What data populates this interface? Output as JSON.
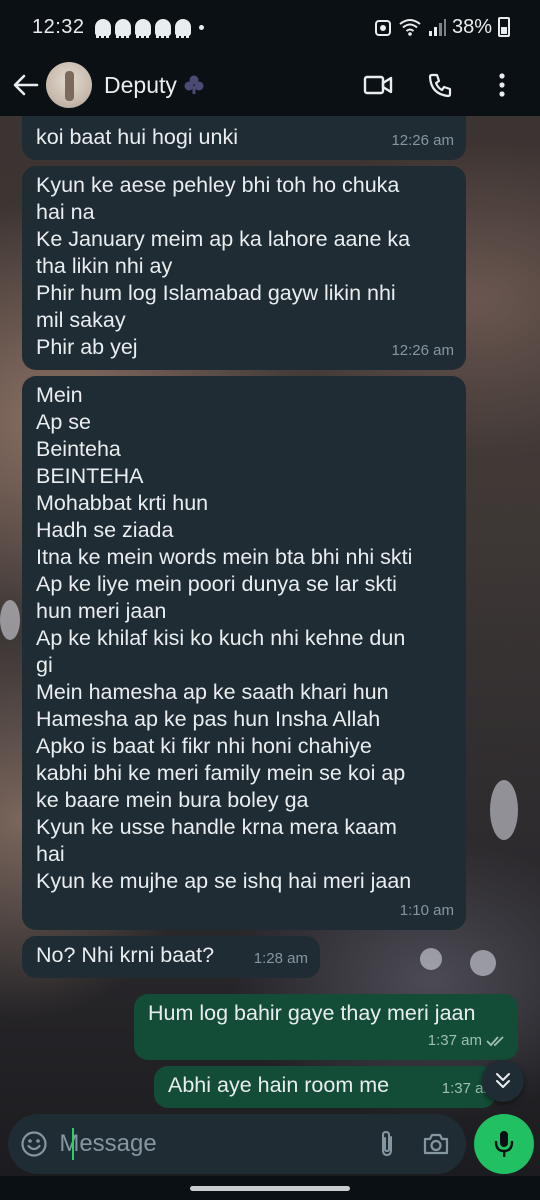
{
  "status_bar": {
    "time": "12:32",
    "battery": "38%"
  },
  "header": {
    "contact_name": "Deputy",
    "icons": [
      "back-arrow-icon",
      "avatar",
      "club-icon",
      "video-call-icon",
      "voice-call-icon",
      "more-vert-icon"
    ]
  },
  "messages": [
    {
      "direction": "in",
      "text": "koi baat hui hogi unki",
      "time": "12:26 am"
    },
    {
      "direction": "in",
      "text": "Kyun ke aese pehley bhi toh ho chuka\nhai na\nKe January meim ap ka lahore aane ka\ntha likin nhi ay\nPhir hum log Islamabad gayw likin nhi\nmil sakay\nPhir ab yej",
      "time": "12:26 am"
    },
    {
      "direction": "in",
      "text": "Mein\nAp se\nBeinteha\nBEINTEHA\nMohabbat krti hun\nHadh se ziada\nItna ke mein words mein bta bhi nhi skti\nAp ke liye mein poori dunya se lar skti\nhun meri jaan\nAp ke khilaf kisi ko kuch nhi kehne dun\ngi\nMein hamesha ap ke saath khari hun\nHamesha ap ke pas hun Insha Allah\nApko is baat ki fikr nhi honi chahiye\nkabhi bhi ke meri family mein se koi ap\nke baare mein bura boley ga\nKyun ke usse handle krna mera kaam\nhai\nKyun ke mujhe ap se ishq hai meri jaan",
      "time": "1:10 am"
    },
    {
      "direction": "in",
      "text": "No? Nhi krni baat?",
      "time": "1:28 am"
    },
    {
      "direction": "out",
      "text": "Hum log bahir gaye thay meri jaan",
      "time": "1:37 am",
      "status": "read"
    },
    {
      "direction": "out",
      "text": "Abhi aye hain room me",
      "time": "1:37 am",
      "status": "read"
    }
  ],
  "input": {
    "placeholder": "Message"
  },
  "colors": {
    "incoming_bubble": "#1f2c33",
    "outgoing_bubble": "#134d37",
    "accent_green": "#21c063",
    "bar_background": "#0b1014"
  }
}
